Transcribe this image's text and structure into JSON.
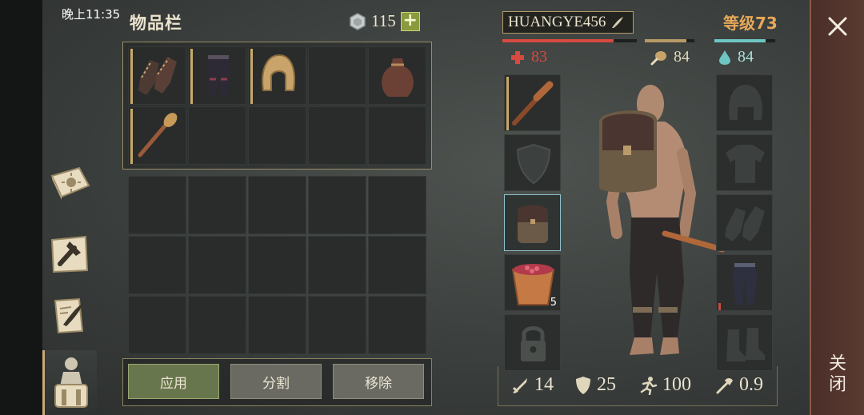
{
  "status": {
    "time": "晚上11:35"
  },
  "inventory": {
    "title": "物品栏",
    "currency": {
      "value": "115",
      "plus": "+"
    },
    "actions": {
      "apply": "应用",
      "split": "分割",
      "remove": "移除"
    }
  },
  "character": {
    "name": "HUANGYE456",
    "level": "等级73",
    "health": {
      "value": "83",
      "fraction": 0.83
    },
    "food": {
      "value": "84",
      "fraction": 0.84
    },
    "water": {
      "value": "84",
      "fraction": 0.84
    },
    "bottom_stats": {
      "attack": "14",
      "defense": "25",
      "speed": "100",
      "tool": "0.9"
    },
    "backpack_slot_count": "5"
  },
  "close": {
    "label": "关闭"
  },
  "colors": {
    "health": "#d74a3f",
    "food": "#b89a66",
    "water": "#6ec6c4",
    "level": "#e6a95a"
  }
}
